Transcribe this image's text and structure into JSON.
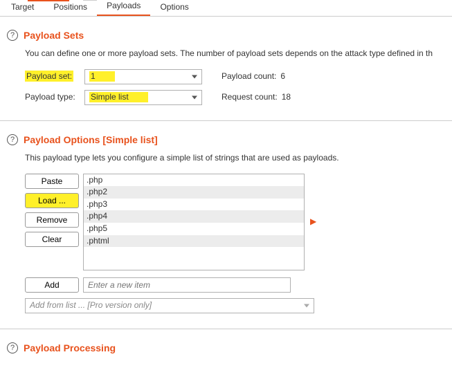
{
  "tabs": {
    "target": "Target",
    "positions": "Positions",
    "payloads": "Payloads",
    "options": "Options"
  },
  "sets": {
    "title": "Payload Sets",
    "desc": "You can define one or more payload sets. The number of payload sets depends on the attack type defined in th",
    "payload_set_label": "Payload set:",
    "payload_set_value": "1",
    "payload_type_label": "Payload type:",
    "payload_type_value": "Simple list",
    "payload_count_label": "Payload count:",
    "payload_count_value": "6",
    "request_count_label": "Request count:",
    "request_count_value": "18"
  },
  "options": {
    "title": "Payload Options [Simple list]",
    "desc": "This payload type lets you configure a simple list of strings that are used as payloads.",
    "buttons": {
      "paste": "Paste",
      "load": "Load ...",
      "remove": "Remove",
      "clear": "Clear",
      "add": "Add"
    },
    "items": [
      ".php",
      ".php2",
      ".php3",
      ".php4",
      ".php5",
      ".phtml"
    ],
    "new_item_placeholder": "Enter a new item",
    "pro_placeholder": "Add from list ... [Pro version only]"
  },
  "processing": {
    "title": "Payload Processing"
  }
}
